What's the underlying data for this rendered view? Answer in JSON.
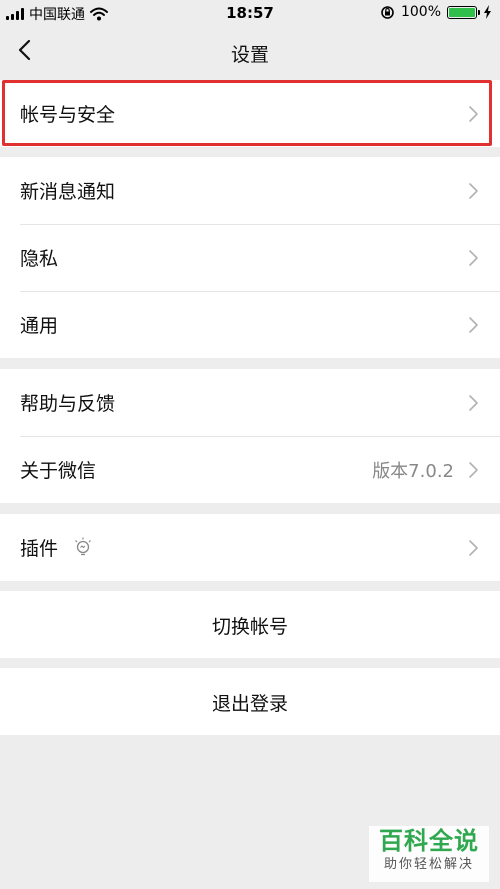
{
  "status_bar": {
    "carrier": "中国联通",
    "time": "18:57",
    "battery_percent": "100%",
    "battery_level": 1.0
  },
  "nav": {
    "back_icon": "chevron-left-icon",
    "title": "设置"
  },
  "groups": {
    "account": {
      "items": [
        {
          "label": "帐号与安全"
        }
      ]
    },
    "general": {
      "items": [
        {
          "label": "新消息通知"
        },
        {
          "label": "隐私"
        },
        {
          "label": "通用"
        }
      ]
    },
    "about": {
      "items": [
        {
          "label": "帮助与反馈"
        },
        {
          "label": "关于微信",
          "value": "版本7.0.2"
        }
      ]
    },
    "plugins": {
      "items": [
        {
          "label": "插件",
          "icon": "lightbulb-icon"
        }
      ]
    },
    "switch_account": {
      "label": "切换帐号"
    },
    "logout": {
      "label": "退出登录"
    }
  },
  "watermark": {
    "title": "百科全说",
    "subtitle": "助你轻松解决"
  },
  "colors": {
    "background": "#ededed",
    "highlight_border": "#e03030",
    "battery_fill": "#2fbf4a",
    "watermark_green": "#2fa84f"
  }
}
